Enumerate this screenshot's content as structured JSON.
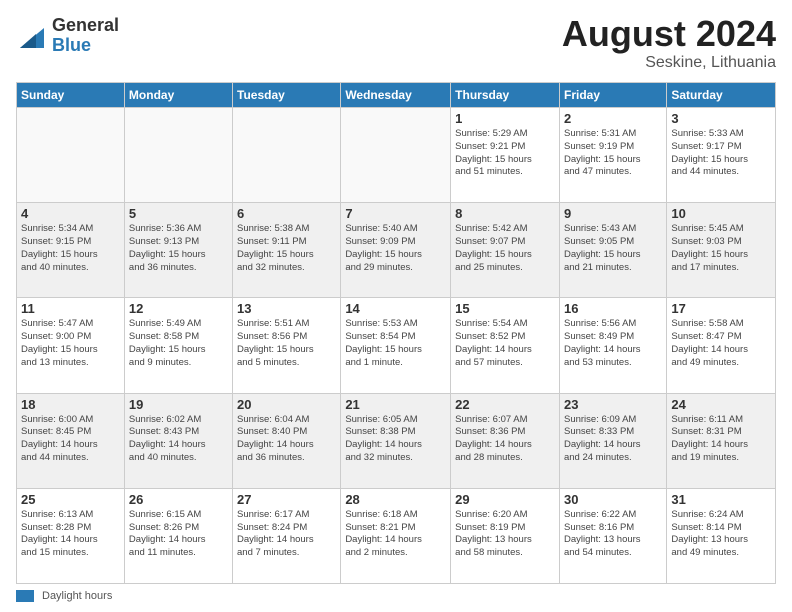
{
  "header": {
    "logo_general": "General",
    "logo_blue": "Blue",
    "title": "August 2024",
    "location": "Seskine, Lithuania"
  },
  "days_of_week": [
    "Sunday",
    "Monday",
    "Tuesday",
    "Wednesday",
    "Thursday",
    "Friday",
    "Saturday"
  ],
  "footer": {
    "legend_label": "Daylight hours"
  },
  "weeks": [
    {
      "row_class": "row-odd",
      "days": [
        {
          "num": "",
          "info": "",
          "empty": true
        },
        {
          "num": "",
          "info": "",
          "empty": true
        },
        {
          "num": "",
          "info": "",
          "empty": true
        },
        {
          "num": "",
          "info": "",
          "empty": true
        },
        {
          "num": "1",
          "info": "Sunrise: 5:29 AM\nSunset: 9:21 PM\nDaylight: 15 hours\nand 51 minutes.",
          "empty": false
        },
        {
          "num": "2",
          "info": "Sunrise: 5:31 AM\nSunset: 9:19 PM\nDaylight: 15 hours\nand 47 minutes.",
          "empty": false
        },
        {
          "num": "3",
          "info": "Sunrise: 5:33 AM\nSunset: 9:17 PM\nDaylight: 15 hours\nand 44 minutes.",
          "empty": false
        }
      ]
    },
    {
      "row_class": "row-even",
      "days": [
        {
          "num": "4",
          "info": "Sunrise: 5:34 AM\nSunset: 9:15 PM\nDaylight: 15 hours\nand 40 minutes.",
          "empty": false
        },
        {
          "num": "5",
          "info": "Sunrise: 5:36 AM\nSunset: 9:13 PM\nDaylight: 15 hours\nand 36 minutes.",
          "empty": false
        },
        {
          "num": "6",
          "info": "Sunrise: 5:38 AM\nSunset: 9:11 PM\nDaylight: 15 hours\nand 32 minutes.",
          "empty": false
        },
        {
          "num": "7",
          "info": "Sunrise: 5:40 AM\nSunset: 9:09 PM\nDaylight: 15 hours\nand 29 minutes.",
          "empty": false
        },
        {
          "num": "8",
          "info": "Sunrise: 5:42 AM\nSunset: 9:07 PM\nDaylight: 15 hours\nand 25 minutes.",
          "empty": false
        },
        {
          "num": "9",
          "info": "Sunrise: 5:43 AM\nSunset: 9:05 PM\nDaylight: 15 hours\nand 21 minutes.",
          "empty": false
        },
        {
          "num": "10",
          "info": "Sunrise: 5:45 AM\nSunset: 9:03 PM\nDaylight: 15 hours\nand 17 minutes.",
          "empty": false
        }
      ]
    },
    {
      "row_class": "row-odd",
      "days": [
        {
          "num": "11",
          "info": "Sunrise: 5:47 AM\nSunset: 9:00 PM\nDaylight: 15 hours\nand 13 minutes.",
          "empty": false
        },
        {
          "num": "12",
          "info": "Sunrise: 5:49 AM\nSunset: 8:58 PM\nDaylight: 15 hours\nand 9 minutes.",
          "empty": false
        },
        {
          "num": "13",
          "info": "Sunrise: 5:51 AM\nSunset: 8:56 PM\nDaylight: 15 hours\nand 5 minutes.",
          "empty": false
        },
        {
          "num": "14",
          "info": "Sunrise: 5:53 AM\nSunset: 8:54 PM\nDaylight: 15 hours\nand 1 minute.",
          "empty": false
        },
        {
          "num": "15",
          "info": "Sunrise: 5:54 AM\nSunset: 8:52 PM\nDaylight: 14 hours\nand 57 minutes.",
          "empty": false
        },
        {
          "num": "16",
          "info": "Sunrise: 5:56 AM\nSunset: 8:49 PM\nDaylight: 14 hours\nand 53 minutes.",
          "empty": false
        },
        {
          "num": "17",
          "info": "Sunrise: 5:58 AM\nSunset: 8:47 PM\nDaylight: 14 hours\nand 49 minutes.",
          "empty": false
        }
      ]
    },
    {
      "row_class": "row-even",
      "days": [
        {
          "num": "18",
          "info": "Sunrise: 6:00 AM\nSunset: 8:45 PM\nDaylight: 14 hours\nand 44 minutes.",
          "empty": false
        },
        {
          "num": "19",
          "info": "Sunrise: 6:02 AM\nSunset: 8:43 PM\nDaylight: 14 hours\nand 40 minutes.",
          "empty": false
        },
        {
          "num": "20",
          "info": "Sunrise: 6:04 AM\nSunset: 8:40 PM\nDaylight: 14 hours\nand 36 minutes.",
          "empty": false
        },
        {
          "num": "21",
          "info": "Sunrise: 6:05 AM\nSunset: 8:38 PM\nDaylight: 14 hours\nand 32 minutes.",
          "empty": false
        },
        {
          "num": "22",
          "info": "Sunrise: 6:07 AM\nSunset: 8:36 PM\nDaylight: 14 hours\nand 28 minutes.",
          "empty": false
        },
        {
          "num": "23",
          "info": "Sunrise: 6:09 AM\nSunset: 8:33 PM\nDaylight: 14 hours\nand 24 minutes.",
          "empty": false
        },
        {
          "num": "24",
          "info": "Sunrise: 6:11 AM\nSunset: 8:31 PM\nDaylight: 14 hours\nand 19 minutes.",
          "empty": false
        }
      ]
    },
    {
      "row_class": "row-odd",
      "days": [
        {
          "num": "25",
          "info": "Sunrise: 6:13 AM\nSunset: 8:28 PM\nDaylight: 14 hours\nand 15 minutes.",
          "empty": false
        },
        {
          "num": "26",
          "info": "Sunrise: 6:15 AM\nSunset: 8:26 PM\nDaylight: 14 hours\nand 11 minutes.",
          "empty": false
        },
        {
          "num": "27",
          "info": "Sunrise: 6:17 AM\nSunset: 8:24 PM\nDaylight: 14 hours\nand 7 minutes.",
          "empty": false
        },
        {
          "num": "28",
          "info": "Sunrise: 6:18 AM\nSunset: 8:21 PM\nDaylight: 14 hours\nand 2 minutes.",
          "empty": false
        },
        {
          "num": "29",
          "info": "Sunrise: 6:20 AM\nSunset: 8:19 PM\nDaylight: 13 hours\nand 58 minutes.",
          "empty": false
        },
        {
          "num": "30",
          "info": "Sunrise: 6:22 AM\nSunset: 8:16 PM\nDaylight: 13 hours\nand 54 minutes.",
          "empty": false
        },
        {
          "num": "31",
          "info": "Sunrise: 6:24 AM\nSunset: 8:14 PM\nDaylight: 13 hours\nand 49 minutes.",
          "empty": false
        }
      ]
    }
  ]
}
